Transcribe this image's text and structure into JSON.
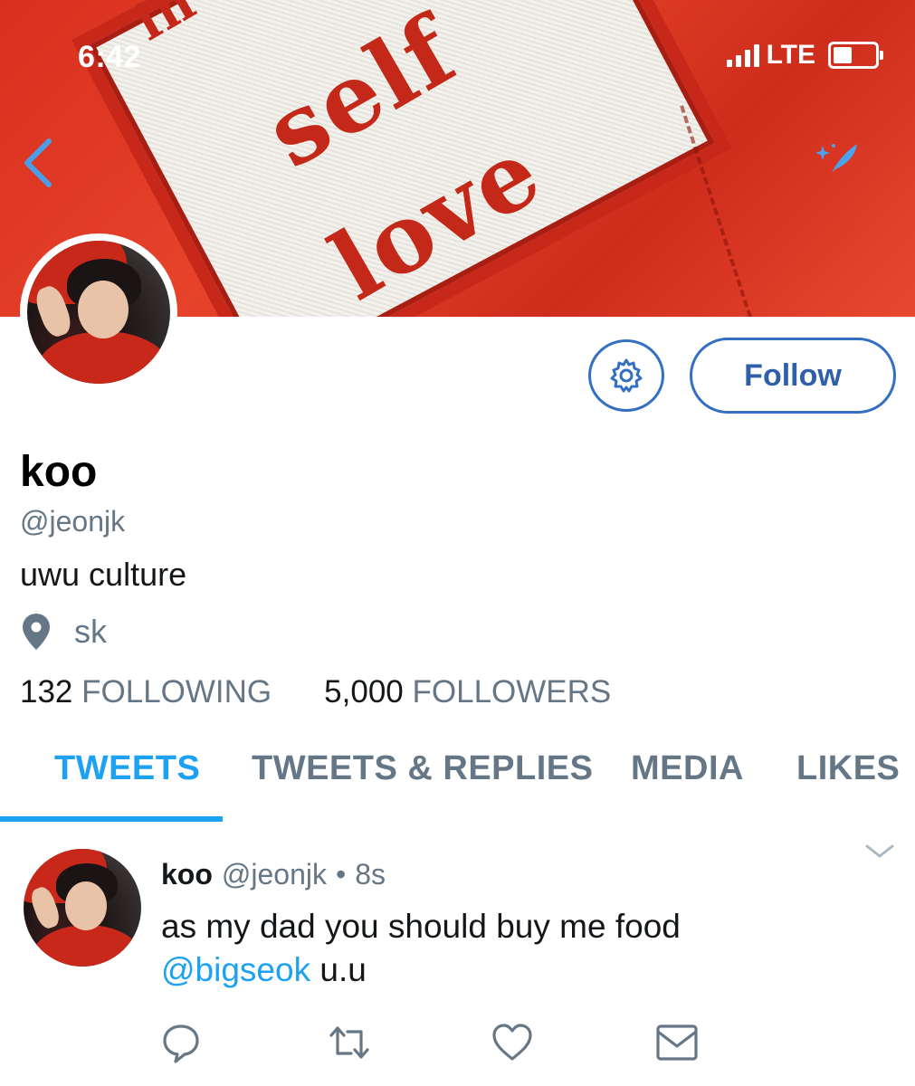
{
  "status_bar": {
    "time": "6:42",
    "network": "LTE",
    "icons": [
      "signal-icon",
      "battery-icon"
    ]
  },
  "header": {
    "banner_text": [
      "in",
      "self",
      "love"
    ],
    "back_icon": "back-chevron-icon",
    "compose_icon": "compose-tweet-icon"
  },
  "profile": {
    "name": "koo",
    "handle": "@jeonjk",
    "bio": "uwu culture",
    "location": "sk",
    "following_count": "132",
    "following_label": "FOLLOWING",
    "followers_count": "5,000",
    "followers_label": "FOLLOWERS"
  },
  "actions": {
    "follow_label": "Follow",
    "settings_icon": "gear-icon"
  },
  "tabs": [
    {
      "label": "TWEETS",
      "active": true
    },
    {
      "label": "TWEETS & REPLIES",
      "active": false
    },
    {
      "label": "MEDIA",
      "active": false
    },
    {
      "label": "LIKES",
      "active": false
    }
  ],
  "tweet": {
    "name": "koo",
    "handle": "@jeonjk",
    "separator": "•",
    "time": "8s",
    "text_line1": "as my dad you should buy me food",
    "mention": "@bigseok",
    "text_tail": " u.u",
    "action_icons": [
      "reply-icon",
      "retweet-icon",
      "like-icon",
      "dm-icon"
    ]
  },
  "colors": {
    "accent": "#1da1f2",
    "button_blue": "#3470c2",
    "muted": "#657786",
    "banner_red": "#d8301f"
  }
}
